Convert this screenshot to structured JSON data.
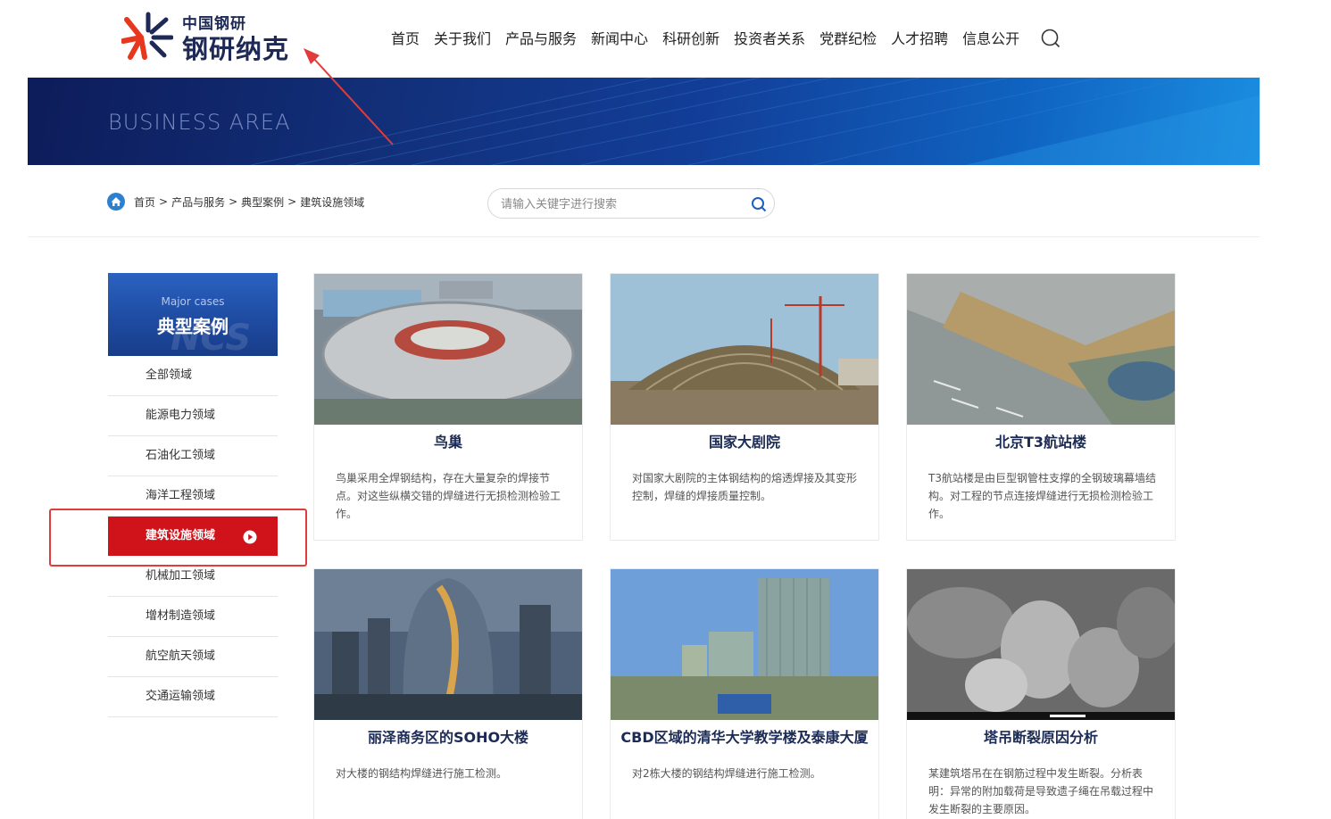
{
  "logo": {
    "small": "中国钢研",
    "big": "钢研纳克"
  },
  "nav": [
    "首页",
    "关于我们",
    "产品与服务",
    "新闻中心",
    "科研创新",
    "投资者关系",
    "党群纪检",
    "人才招聘",
    "信息公开"
  ],
  "banner": {
    "text": "BUSINESS AREA"
  },
  "breadcrumb": {
    "items": [
      "首页",
      "产品与服务",
      "典型案例",
      "建筑设施领域"
    ],
    "sep": ">"
  },
  "search": {
    "placeholder": "请输入关键字进行搜索"
  },
  "sidebar": {
    "en": "Major cases",
    "cn": "典型案例",
    "watermark": "NCS",
    "items": [
      "全部领域",
      "能源电力领域",
      "石油化工领域",
      "海洋工程领域",
      "建筑设施领域",
      "机械加工领域",
      "增材制造领域",
      "航空航天领域",
      "交通运输领域"
    ],
    "active_index": 4
  },
  "cases": [
    {
      "title": "鸟巢",
      "desc": "鸟巢采用全焊钢结构，存在大量复杂的焊接节点。对这些纵横交错的焊缝进行无损检测检验工作。"
    },
    {
      "title": "国家大剧院",
      "desc": "对国家大剧院的主体钢结构的熔透焊接及其变形控制，焊缝的焊接质量控制。"
    },
    {
      "title": "北京T3航站楼",
      "desc": "T3航站楼是由巨型钢管柱支撑的全钢玻璃幕墙结构。对工程的节点连接焊缝进行无损检测检验工作。"
    },
    {
      "title": "丽泽商务区的SOHO大楼",
      "desc": "对大楼的钢结构焊缝进行施工检测。"
    },
    {
      "title": "CBD区域的清华大学教学楼及泰康大厦",
      "desc": "对2栋大楼的钢结构焊缝进行施工检测。"
    },
    {
      "title": "塔吊断裂原因分析",
      "desc": "某建筑塔吊在在钢筋过程中发生断裂。分析表明：异常的附加载荷是导致遗子绳在吊载过程中发生断裂的主要原因。"
    }
  ],
  "colors": {
    "accent": "#d0121b",
    "navy": "#1c2b55",
    "banner": "#123e98"
  }
}
